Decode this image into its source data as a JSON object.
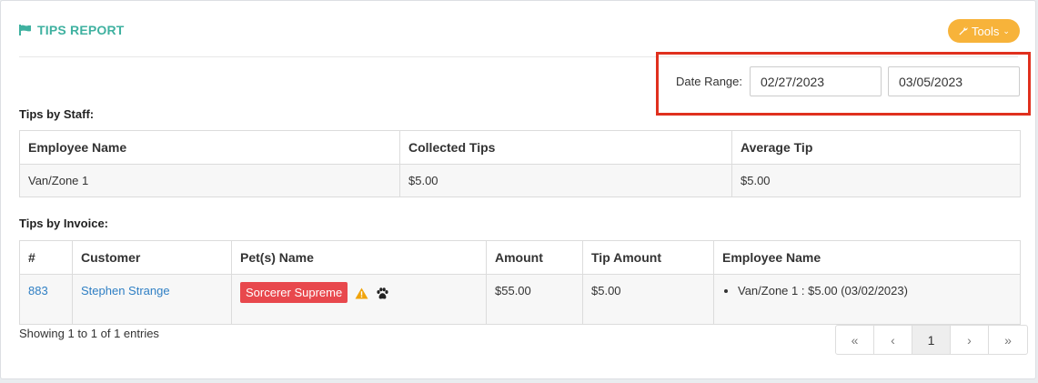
{
  "header": {
    "title": "TIPS REPORT",
    "tools_label": "Tools"
  },
  "date_range": {
    "label": "Date Range:",
    "start": "02/27/2023",
    "end": "03/05/2023"
  },
  "tips_by_staff": {
    "label": "Tips by Staff:",
    "columns": [
      "Employee Name",
      "Collected Tips",
      "Average Tip"
    ],
    "rows": [
      {
        "employee": "Van/Zone 1",
        "collected": "$5.00",
        "average": "$5.00"
      }
    ]
  },
  "tips_by_invoice": {
    "label": "Tips by Invoice:",
    "columns": [
      "#",
      "Customer",
      "Pet(s) Name",
      "Amount",
      "Tip Amount",
      "Employee Name"
    ],
    "rows": [
      {
        "number": "883",
        "customer": "Stephen Strange",
        "pet": "Sorcerer Supreme",
        "amount": "$55.00",
        "tip": "$5.00",
        "employee_entry": "Van/Zone 1 : $5.00 (03/02/2023)"
      }
    ]
  },
  "footer": {
    "showing": "Showing 1 to 1 of 1 entries",
    "pagination": {
      "first": "«",
      "prev": "‹",
      "current": "1",
      "next": "›",
      "last": "»"
    }
  },
  "colors": {
    "title": "#3fb1a0",
    "tools_button": "#f7b33a",
    "highlight_box": "#e0301e",
    "pet_badge": "#e8484d",
    "link": "#2f7fc4",
    "warning": "#f0a30a"
  },
  "icons": {
    "title": "flag-icon",
    "tools": "wrench-icon",
    "tools_chevron": "chevron-down-icon",
    "pet_warning": "warning-icon",
    "pet_paw": "paw-icon"
  }
}
